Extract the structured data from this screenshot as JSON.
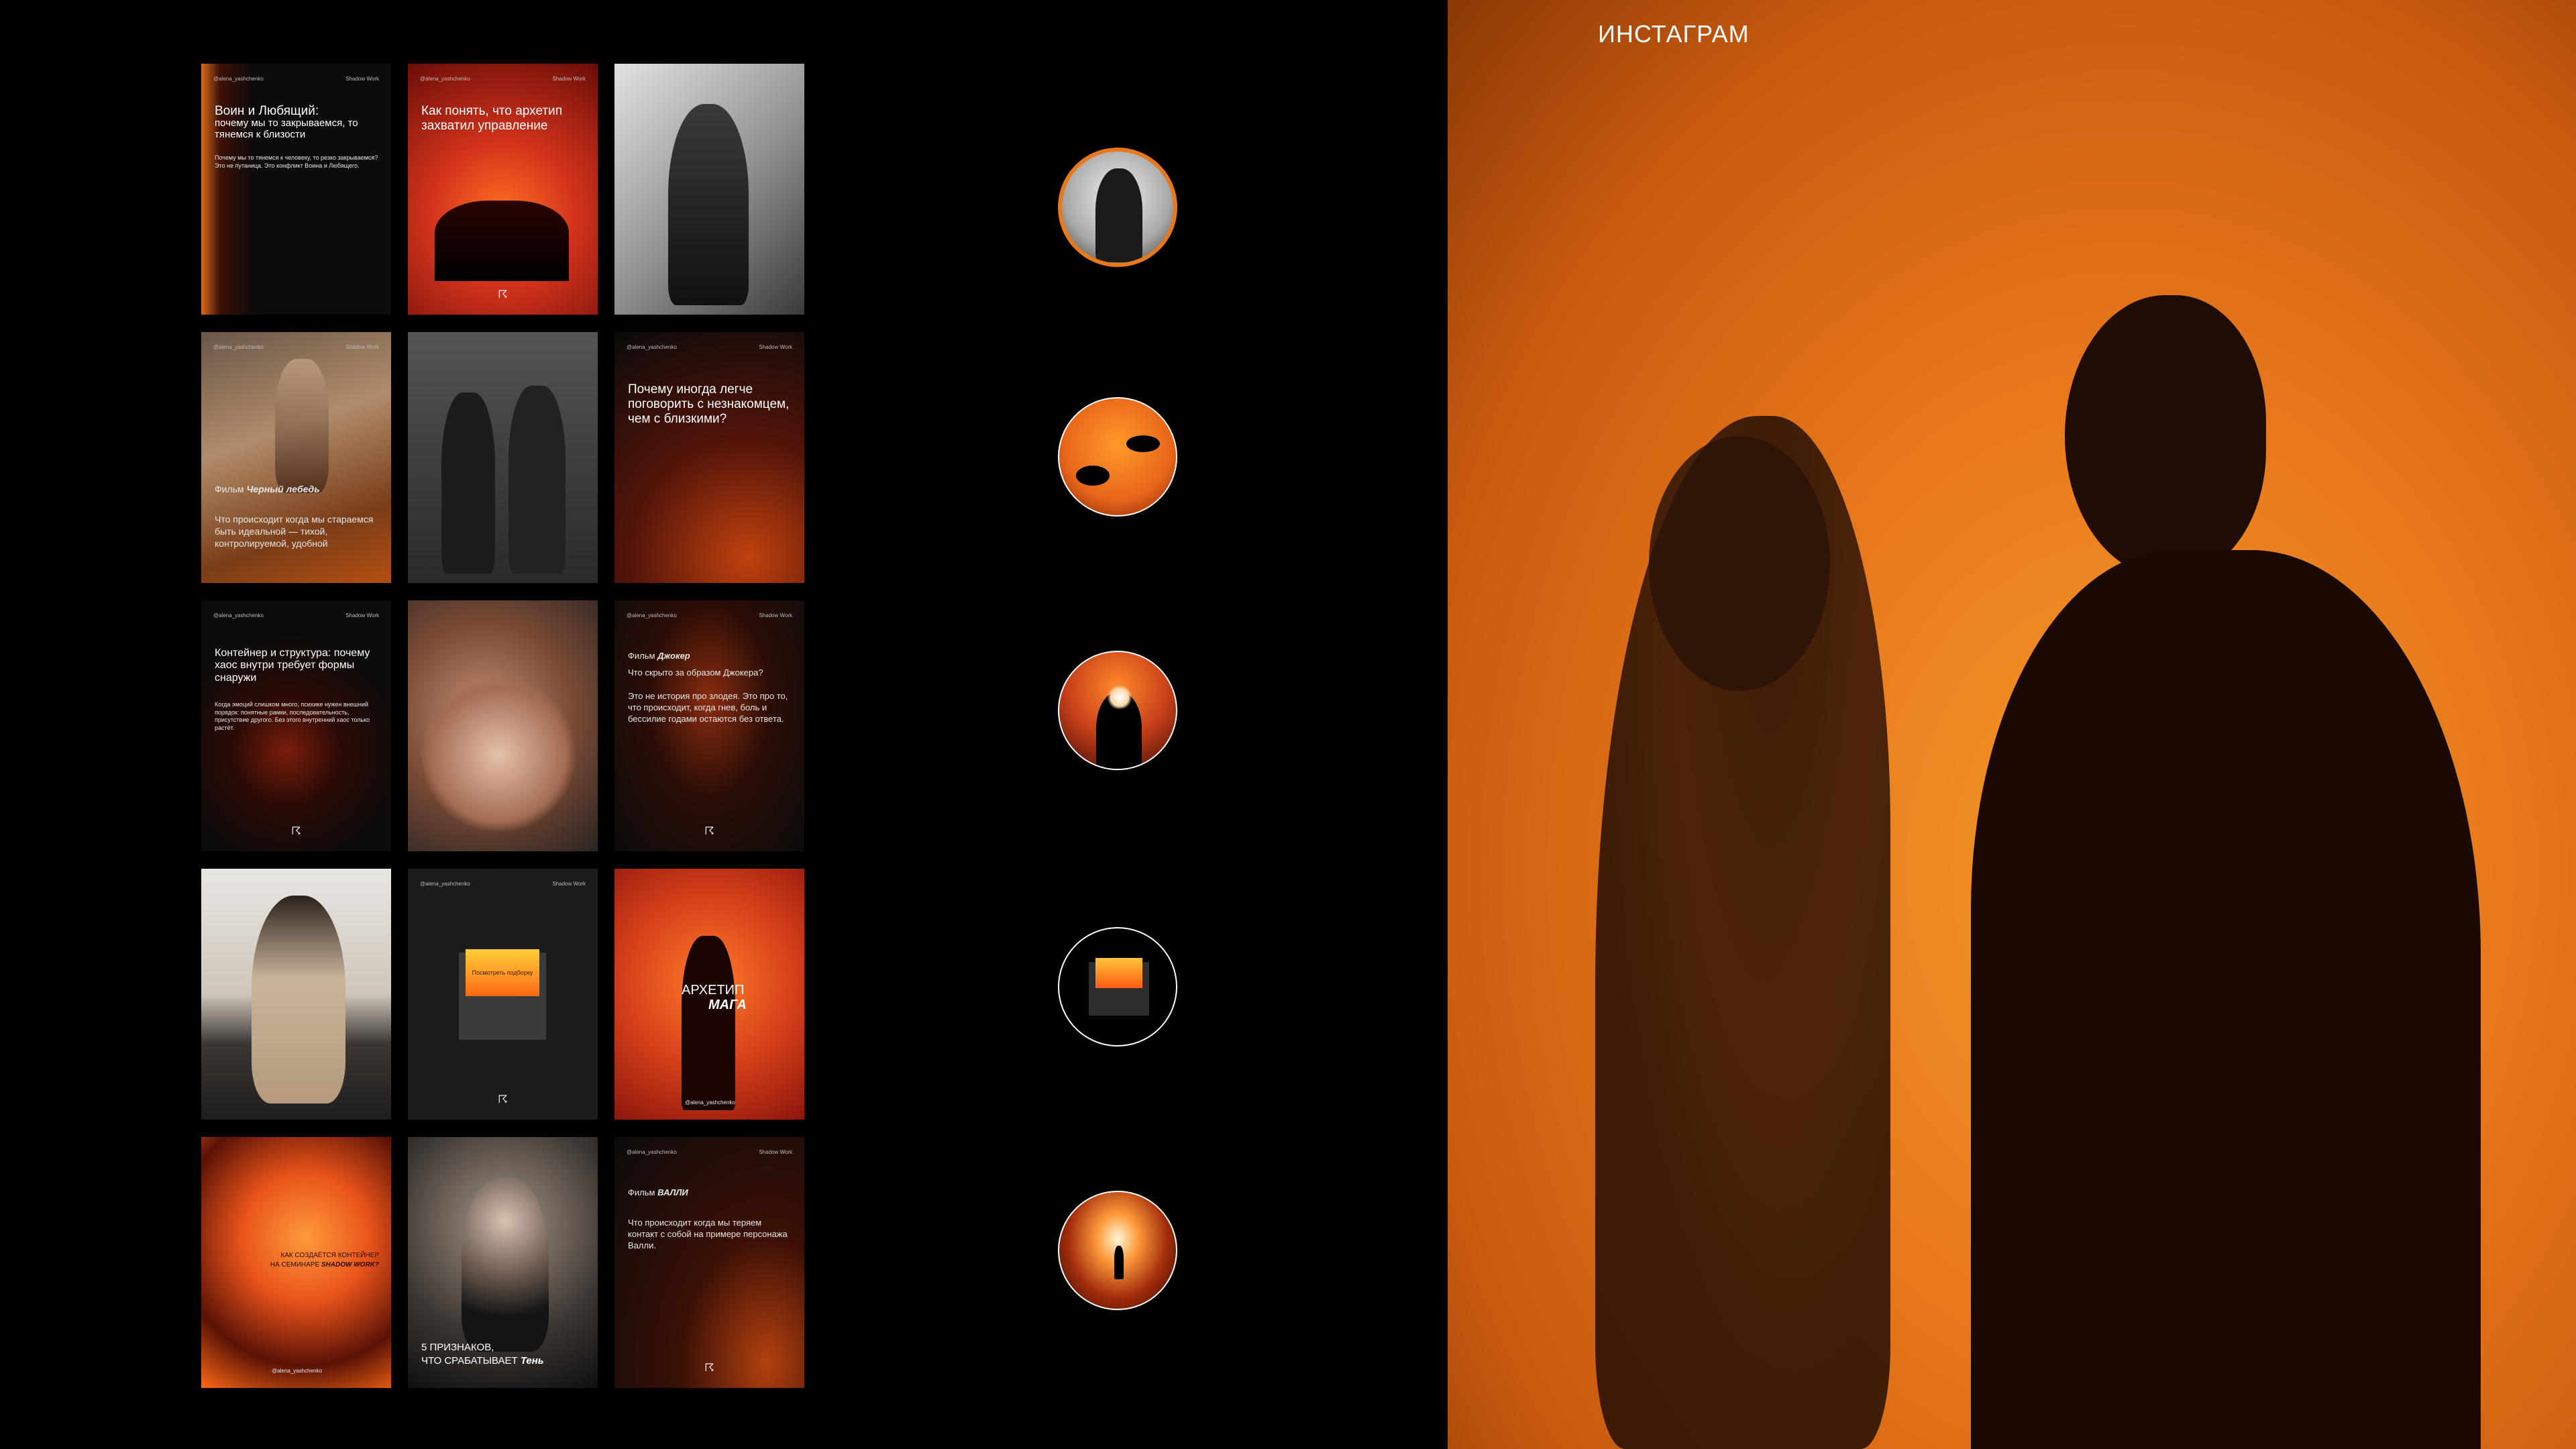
{
  "header": {
    "title": "ИНСТАГРАМ"
  },
  "cards": {
    "c1": {
      "handle": "@alena_yashchenko",
      "tag": "Shadow Work",
      "title": "Воин и Любящий:",
      "subtitle": "почему мы то закрываемся, то тянемся к близости",
      "body": "Почему мы то тянемся к человеку, то резко закрываемся? Это не путаница. Это конфликт Воина и Любящего."
    },
    "c2": {
      "handle": "@alena_yashchenko",
      "tag": "Shadow Work",
      "title": "Как понять, что архетип захватил управление"
    },
    "c4": {
      "handle": "@alena_yashchenko",
      "tag": "Shadow Work",
      "film_prefix": "Фильм",
      "film_name": "Черный лебедь",
      "body": "Что происходит когда мы стараемся быть идеальной — тихой, контролируемой, удобной"
    },
    "c6": {
      "handle": "@alena_yashchenko",
      "tag": "Shadow Work",
      "title": "Почему иногда легче поговорить с незнакомцем, чем с близкими?"
    },
    "c7": {
      "handle": "@alena_yashchenko",
      "tag": "Shadow Work",
      "title": "Контейнер и структура: почему хаос внутри требует формы снаружи",
      "body": "Когда эмоций слишком много, психике нужен внешний порядок: понятные рамки, последовательность, присутствие другого. Без этого внутренний хаос только растёт."
    },
    "c9": {
      "handle": "@alena_yashchenko",
      "tag": "Shadow Work",
      "film_prefix": "Фильм",
      "film_name": "Джокер",
      "question": "Что скрыто за образом Джокера?",
      "body": "Это не история про злодея. Это про то, что происходит, когда гнев, боль и бессилие годами остаются без ответа."
    },
    "c11": {
      "handle": "@alena_yashchenko",
      "tag": "Shadow Work",
      "envelope_text": "Посмотреть подборку"
    },
    "c12": {
      "line1": "АРХЕТИП",
      "line2": "МАГА",
      "handle": "@alena_yashchenko"
    },
    "c13": {
      "line1": "КАК СОЗДАЁТСЯ КОНТЕЙНЕР",
      "line2_prefix": "НА СЕМИНАРЕ",
      "line2_hl": "SHADOW WORK?",
      "handle": "@alena_yashchenko"
    },
    "c14": {
      "line1": "5 ПРИЗНАКОВ,",
      "line2_prefix": "ЧТО СРАБАТЫВАЕТ",
      "line2_hl": "Тень"
    },
    "c15": {
      "handle": "@alena_yashchenko",
      "tag": "Shadow Work",
      "film_prefix": "Фильм",
      "film_name": "ВАЛЛИ",
      "body": "Что происходит когда мы теряем контакт с собой на примере персонажа Валли."
    }
  },
  "logo_glyph": "☈",
  "colors": {
    "accent": "#e8781a",
    "background": "#000000"
  }
}
